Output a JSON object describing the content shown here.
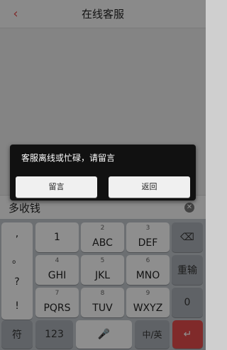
{
  "nav": {
    "title": "在线客服",
    "back_icon": "‹"
  },
  "input": {
    "value": "多收钱",
    "clear_icon": "✕"
  },
  "keyboard": {
    "punct": [
      ",",
      "。",
      "?",
      "!"
    ],
    "row1": [
      {
        "num": "",
        "letters": "1"
      },
      {
        "num": "2",
        "letters": "ABC"
      },
      {
        "num": "3",
        "letters": "DEF"
      }
    ],
    "row2": [
      {
        "num": "4",
        "letters": "GHI"
      },
      {
        "num": "5",
        "letters": "JKL"
      },
      {
        "num": "6",
        "letters": "MNO"
      }
    ],
    "row3": [
      {
        "num": "7",
        "letters": "PQRS"
      },
      {
        "num": "8",
        "letters": "TUV"
      },
      {
        "num": "9",
        "letters": "WXYZ"
      }
    ],
    "delete_icon": "⌫",
    "reenter_label": "重输",
    "zero_label": "0",
    "symbol_label": "符",
    "num_label": "123",
    "mic_icon": "🎤",
    "lang_label": "中/英",
    "enter_icon": "↵"
  },
  "dialog": {
    "message": "客服离线或忙碌，请留言",
    "leave_message_label": "留言",
    "back_label": "返回"
  }
}
